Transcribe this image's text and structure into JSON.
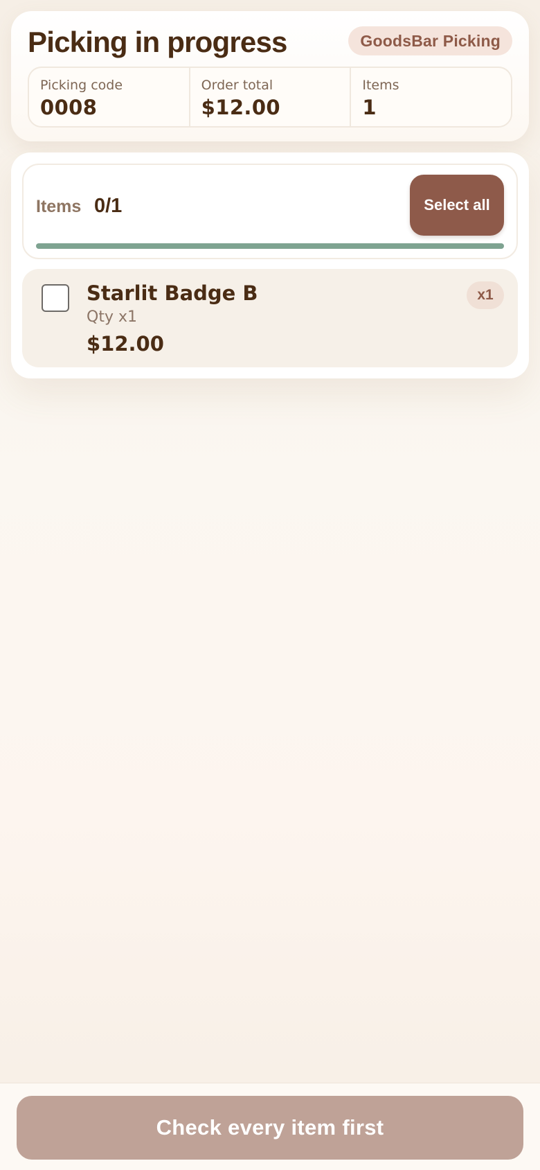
{
  "header": {
    "title": "Picking in progress",
    "brand": "GoodsBar Picking",
    "stats": [
      {
        "label": "Picking code",
        "value": "0008"
      },
      {
        "label": "Order total",
        "value": "$12.00"
      },
      {
        "label": "Items",
        "value": "1"
      }
    ]
  },
  "items_panel": {
    "label": "Items",
    "count": "0/1",
    "picked": 0,
    "total": 1,
    "select_all_label": "Select all",
    "items": [
      {
        "name": "Starlit Badge B",
        "qty_text": "Qty x1",
        "price": "$12.00",
        "badge": "x1",
        "checked": false
      }
    ]
  },
  "footer": {
    "button_label": "Check every item first",
    "button_enabled": false
  },
  "colors": {
    "title_text": "#4a2c14",
    "accent_brown": "#8e5a4a",
    "progress_green": "#7ea391",
    "disabled_button": "#bfa297",
    "item_row_bg": "#f6f0e8"
  }
}
